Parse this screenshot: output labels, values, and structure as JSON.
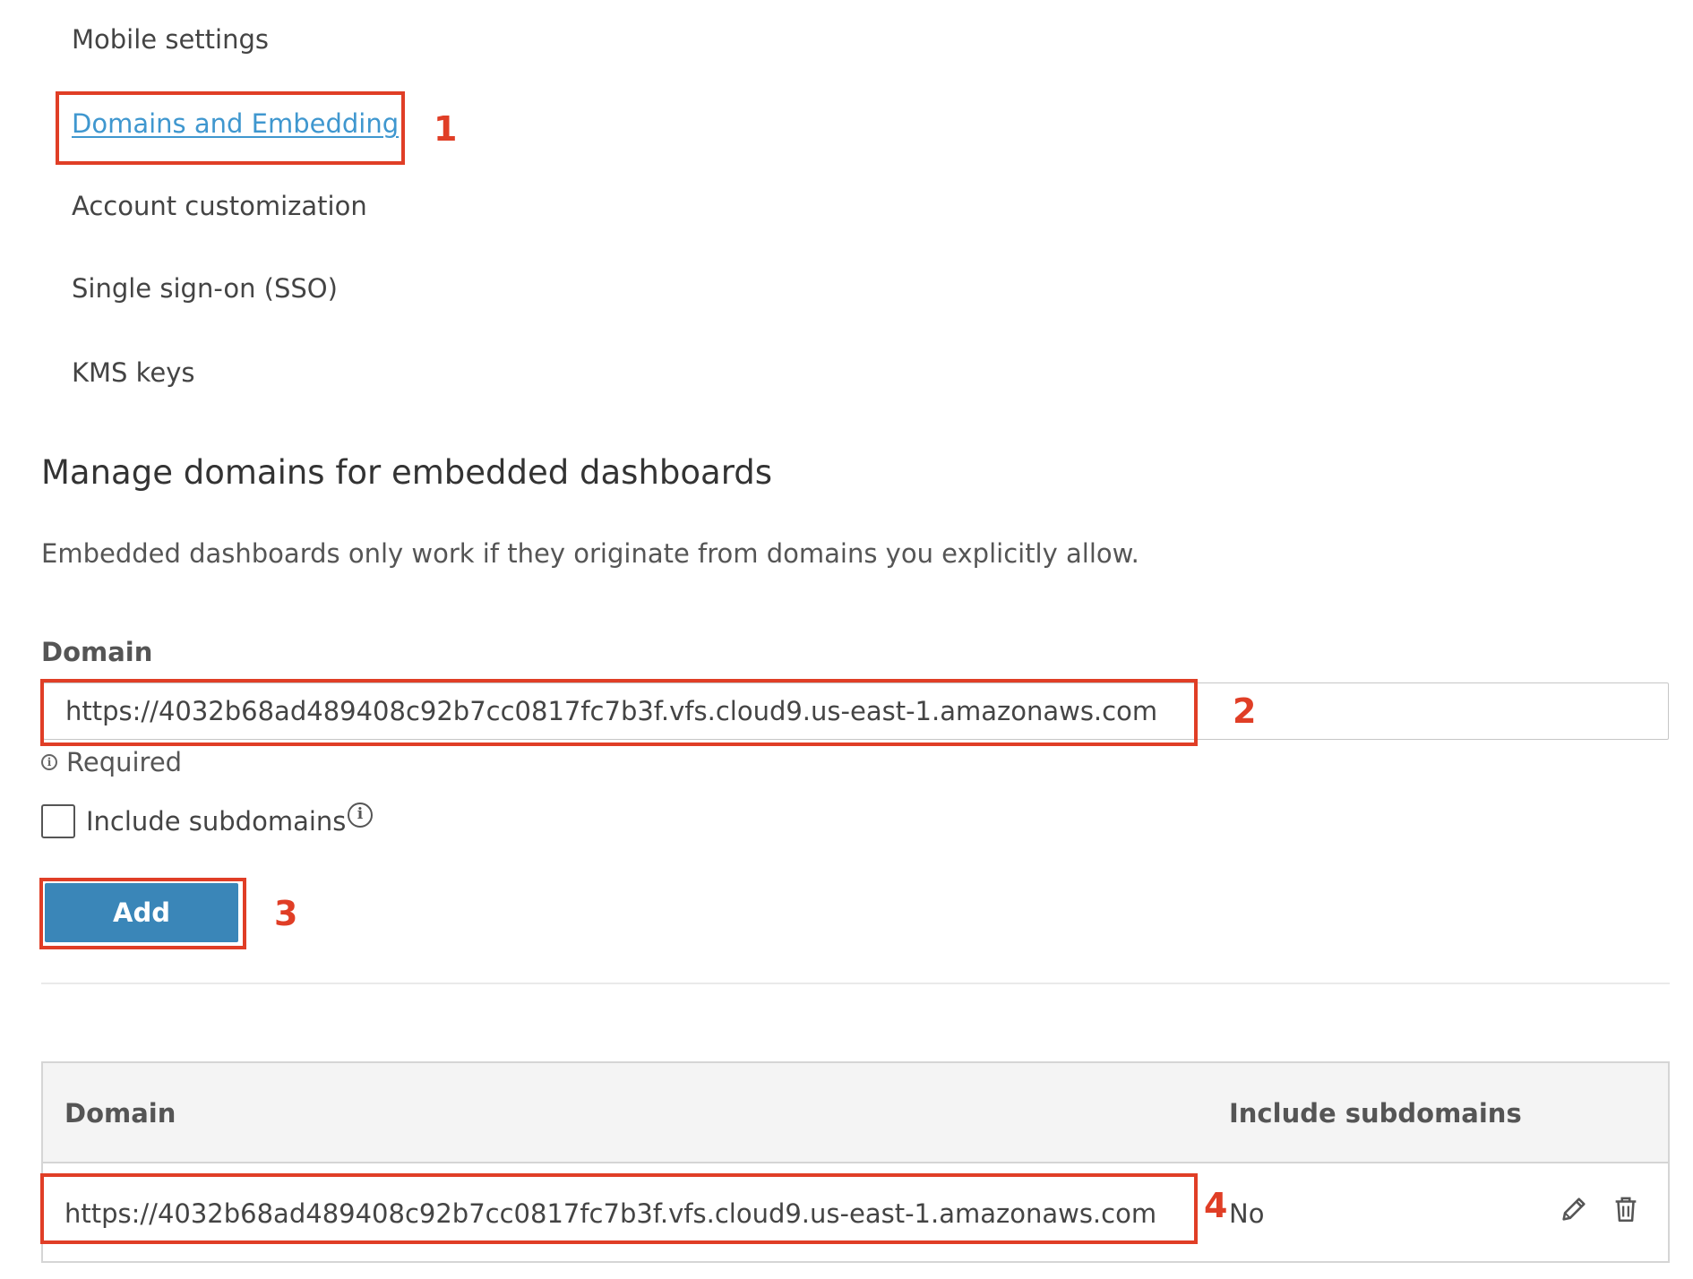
{
  "nav": {
    "items": [
      {
        "label": "Mobile settings"
      },
      {
        "label": "Domains and Embedding"
      },
      {
        "label": "Account customization"
      },
      {
        "label": "Single sign-on (SSO)"
      },
      {
        "label": "KMS keys"
      }
    ]
  },
  "main": {
    "title": "Manage domains for embedded dashboards",
    "description": "Embedded dashboards only work if they originate from domains you explicitly allow.",
    "domain_label": "Domain",
    "domain_value": "https://4032b68ad489408c92b7cc0817fc7b3f.vfs.cloud9.us-east-1.amazonaws.com",
    "required_text": "Required",
    "include_subdomains_label": "Include subdomains",
    "include_subdomains_checked": false,
    "add_button_label": "Add"
  },
  "table": {
    "columns": [
      "Domain",
      "Include subdomains"
    ],
    "rows": [
      {
        "domain": "https://4032b68ad489408c92b7cc0817fc7b3f.vfs.cloud9.us-east-1.amazonaws.com",
        "include_subdomains": "No"
      }
    ],
    "row_actions": [
      "pencil-icon",
      "trash-icon"
    ]
  },
  "annotations": {
    "callouts": [
      "1",
      "2",
      "3",
      "4"
    ],
    "color": "#e03e26"
  },
  "colors": {
    "link": "#3f97cf",
    "button": "#3a86b8",
    "callout": "#e03e26"
  }
}
